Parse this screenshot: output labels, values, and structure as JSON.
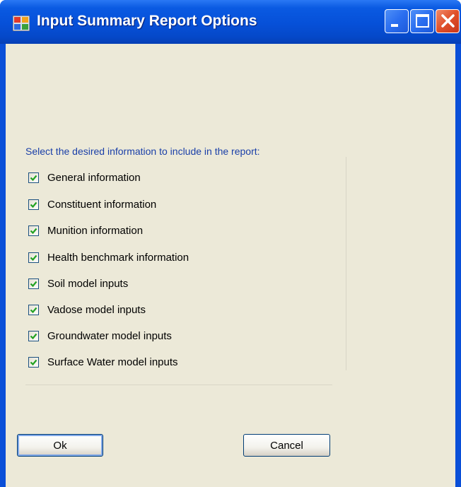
{
  "window": {
    "title": "Input Summary Report Options"
  },
  "title_buttons": [
    "minimize",
    "maximize",
    "close"
  ],
  "prompt": "Select the desired information to include in the report:",
  "options": [
    {
      "label": "General information",
      "checked": true
    },
    {
      "label": "Constituent information",
      "checked": true
    },
    {
      "label": "Munition information",
      "checked": true
    },
    {
      "label": "Health benchmark information",
      "checked": true
    },
    {
      "label": "Soil model inputs",
      "checked": true
    },
    {
      "label": "Vadose model inputs",
      "checked": true
    },
    {
      "label": "Groundwater model inputs",
      "checked": true
    },
    {
      "label": "Surface Water model inputs",
      "checked": true
    }
  ],
  "buttons": {
    "ok": "Ok",
    "cancel": "Cancel"
  },
  "colors": {
    "titlebar": "#0650d8",
    "client": "#ece9d8",
    "prompt_text": "#1a3fa8",
    "check": "#21a121"
  }
}
